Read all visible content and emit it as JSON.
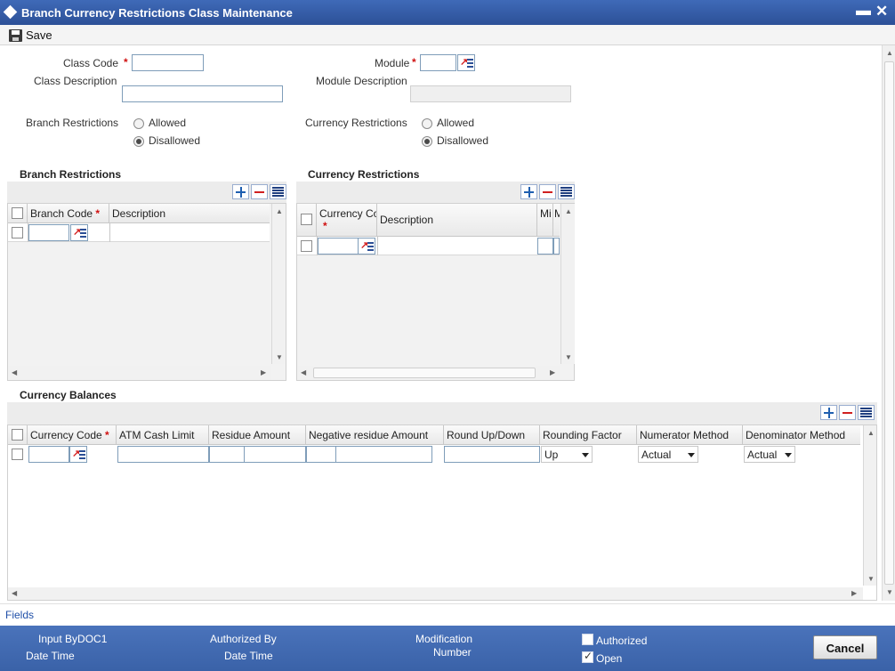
{
  "window": {
    "title": "Branch Currency Restrictions Class Maintenance",
    "minimize_glyph": "▬",
    "close_glyph": "✕"
  },
  "toolbar": {
    "save_label": "Save"
  },
  "form": {
    "class_code_label": "Class Code",
    "class_description_label": "Class Description",
    "module_label": "Module",
    "module_description_label": "Module Description",
    "required_mark": "*",
    "branch_restrictions_label": "Branch Restrictions",
    "currency_restrictions_label": "Currency Restrictions",
    "allowed_label": "Allowed",
    "disallowed_label": "Disallowed",
    "branch_selected": "Disallowed",
    "currency_selected": "Disallowed"
  },
  "branch_grid": {
    "title": "Branch Restrictions",
    "columns": [
      "Branch Code",
      "Description"
    ]
  },
  "currency_grid": {
    "title": "Currency Restrictions",
    "columns": [
      "Currency Co",
      "Description",
      "Mi",
      "M"
    ]
  },
  "balances_grid": {
    "title": "Currency Balances",
    "columns": [
      "Currency Code",
      "ATM Cash Limit",
      "Residue Amount",
      "Negative residue Amount",
      "Round Up/Down",
      "Rounding Factor",
      "Numerator Method",
      "Denominator Method"
    ],
    "row": {
      "round_up_down": "Up",
      "numerator_method": "Actual",
      "denominator_method": "Actual"
    }
  },
  "fields_link": "Fields",
  "footer": {
    "input_by_label": "Input By",
    "input_by_value": "DOC1",
    "date_time_label": "Date Time",
    "authorized_by_label": "Authorized By",
    "modification_label": "Modification",
    "number_label": "Number",
    "authorized_label": "Authorized",
    "open_label": "Open",
    "cancel_label": "Cancel"
  },
  "colors": {
    "title_bar": "#2c5097",
    "footer": "#3a62a8",
    "required": "#d01010",
    "link": "#1f4fa8"
  }
}
